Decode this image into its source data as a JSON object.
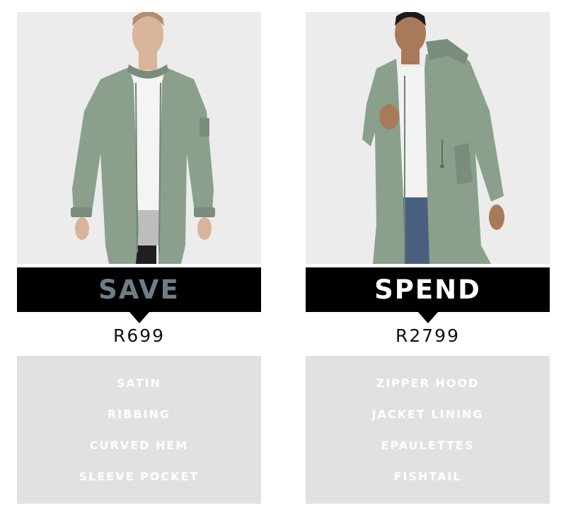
{
  "save": {
    "label": "SAVE",
    "price": "R699",
    "features": [
      "SATIN",
      "RIBBING",
      "CURVED HEM",
      "SLEEVE POCKET"
    ],
    "label_color": "#6f7d86",
    "banner_color": "#000000",
    "photo_alt": "bomber-jacket-photo"
  },
  "spend": {
    "label": "SPEND",
    "price": "R2799",
    "features": [
      "ZIPPER HOOD",
      "JACKET LINING",
      "EPAULETTES",
      "FISHTAIL"
    ],
    "label_color": "#ffffff",
    "banner_color": "#000000",
    "photo_alt": "parka-jacket-photo"
  },
  "colors": {
    "jacket": "#8aa08c",
    "panel": "#e1e1e1",
    "photo_bg": "#ececec"
  }
}
